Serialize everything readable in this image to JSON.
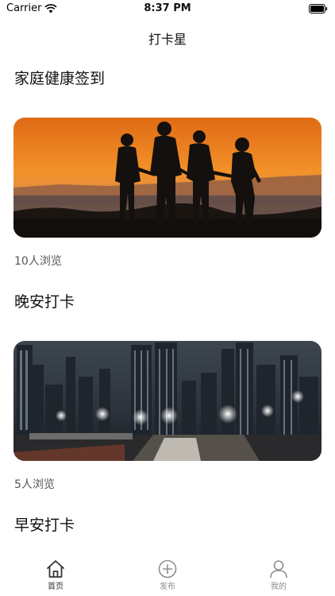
{
  "status_bar": {
    "carrier": "Carrier",
    "time": "8:37 PM"
  },
  "nav": {
    "title": "打卡星"
  },
  "posts": [
    {
      "title": "家庭健康签到",
      "views": "10人浏览",
      "image": "sunset-family-photo"
    },
    {
      "title": "晚安打卡",
      "views": "5人浏览",
      "image": "night-city-photo"
    },
    {
      "title": "早安打卡",
      "views": "",
      "image": ""
    }
  ],
  "tab_bar": {
    "items": [
      {
        "label": "首页",
        "icon": "home-icon",
        "active": true
      },
      {
        "label": "发布",
        "icon": "add-circle-icon",
        "active": false
      },
      {
        "label": "我的",
        "icon": "person-icon",
        "active": false
      }
    ]
  }
}
